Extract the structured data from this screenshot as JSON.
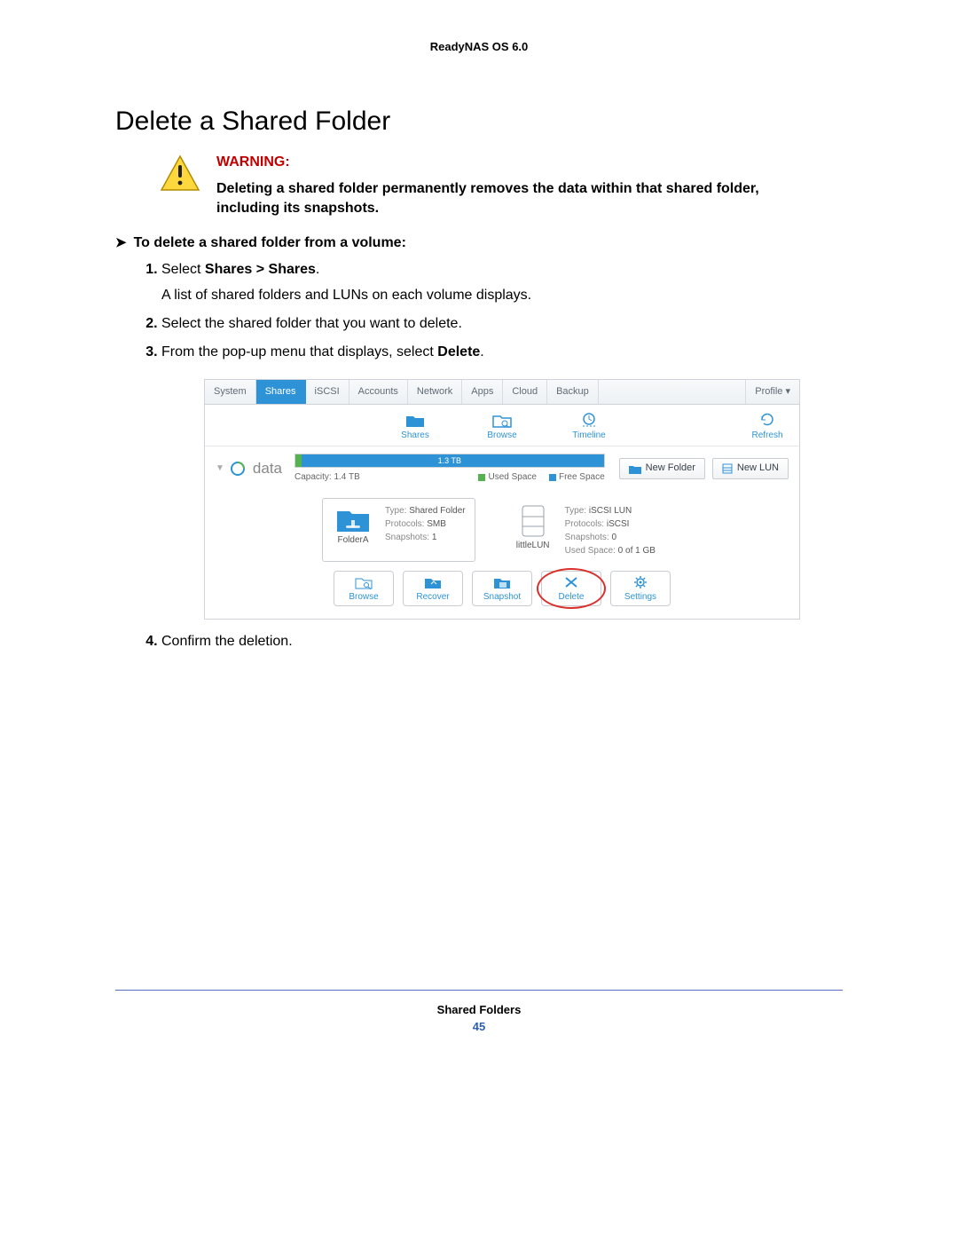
{
  "header": {
    "product": "ReadyNAS OS 6.0"
  },
  "title": "Delete a Shared Folder",
  "warning": {
    "label": "WARNING:",
    "text": "Deleting a shared folder permanently removes the data within that shared folder, including its snapshots."
  },
  "procedure": {
    "heading": "To delete a shared folder from a volume:",
    "steps": {
      "s1_a": "Select ",
      "s1_b": "Shares > Shares",
      "s1_c": ".",
      "s1_sub": "A list of shared folders and LUNs on each volume displays.",
      "s2": "Select the shared folder that you want to delete.",
      "s3_a": "From the pop-up menu that displays, select ",
      "s3_b": "Delete",
      "s3_c": ".",
      "s4": "Confirm the deletion."
    }
  },
  "ui": {
    "tabs": [
      "System",
      "Shares",
      "iSCSI",
      "Accounts",
      "Network",
      "Apps",
      "Cloud",
      "Backup"
    ],
    "profile": "Profile",
    "subbar": {
      "shares": "Shares",
      "browse": "Browse",
      "timeline": "Timeline",
      "refresh": "Refresh"
    },
    "volume": {
      "name": "data",
      "capacity_label": "Capacity: 1.4 TB",
      "bar_label": "1.3 TB",
      "legend_used": "Used Space",
      "legend_free": "Free Space"
    },
    "buttons": {
      "new_folder": "New Folder",
      "new_lun": "New LUN"
    },
    "folder": {
      "name": "FolderA",
      "type_k": "Type:",
      "type_v": "Shared Folder",
      "proto_k": "Protocols:",
      "proto_v": "SMB",
      "snap_k": "Snapshots:",
      "snap_v": "1"
    },
    "lun": {
      "name": "littleLUN",
      "type_k": "Type:",
      "type_v": "iSCSI LUN",
      "proto_k": "Protocols:",
      "proto_v": "iSCSI",
      "snap_k": "Snapshots:",
      "snap_v": "0",
      "used_k": "Used Space:",
      "used_v": "0 of 1 GB"
    },
    "actions": {
      "browse": "Browse",
      "recover": "Recover",
      "snapshot": "Snapshot",
      "delete": "Delete",
      "settings": "Settings"
    }
  },
  "footer": {
    "section": "Shared Folders",
    "page": "45"
  }
}
